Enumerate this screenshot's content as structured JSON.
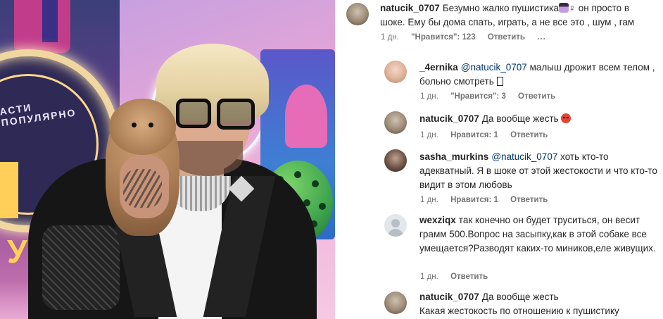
{
  "comments": [
    {
      "username": "natucik_0707",
      "text_before": "Безумно жалко пушистика",
      "text_after": "♀ он просто в шоке. Ему бы дома спать, играть, а не все это , шум , гам",
      "age": "1 дн.",
      "likes": "\"Нравится\": 123",
      "reply": "Ответить",
      "more": "..."
    },
    {
      "username": "_4ernika",
      "mention": "@natucik_0707",
      "text": " малыш дрожит всем телом , больно смотреть ",
      "age": "1 дн.",
      "likes": "\"Нравится\": 3",
      "reply": "Ответить"
    },
    {
      "username": "natucik_0707",
      "text": "Да вообще жесть ",
      "age": "1 дн.",
      "likes": "Нравится: 1",
      "reply": "Ответить"
    },
    {
      "username": "sasha_murkins",
      "mention": "@natucik_0707",
      "text": " хоть кто-то адекватный. Я в шоке от этой жестокости и что кто-то видит в этом любовь",
      "age": "1 дн.",
      "likes": "Нравится: 1",
      "reply": "Ответить"
    },
    {
      "username": "wexziqx",
      "text": "так конечно он будет труситься, он весит грамм 500.Вопрос на засыпку,как в этой собаке все умещается?Разводят каких-то миников,еле живущих.",
      "age": "1 дн.",
      "reply": "Ответить"
    },
    {
      "username": "natucik_0707",
      "text": "Да вообще жесть",
      "line2": "Какая жестокость по отношению к пушистику"
    }
  ],
  "photo": {
    "ring_text": "АСТИ ПОПУЛЯРНО",
    "logo_text": "УЗ"
  }
}
